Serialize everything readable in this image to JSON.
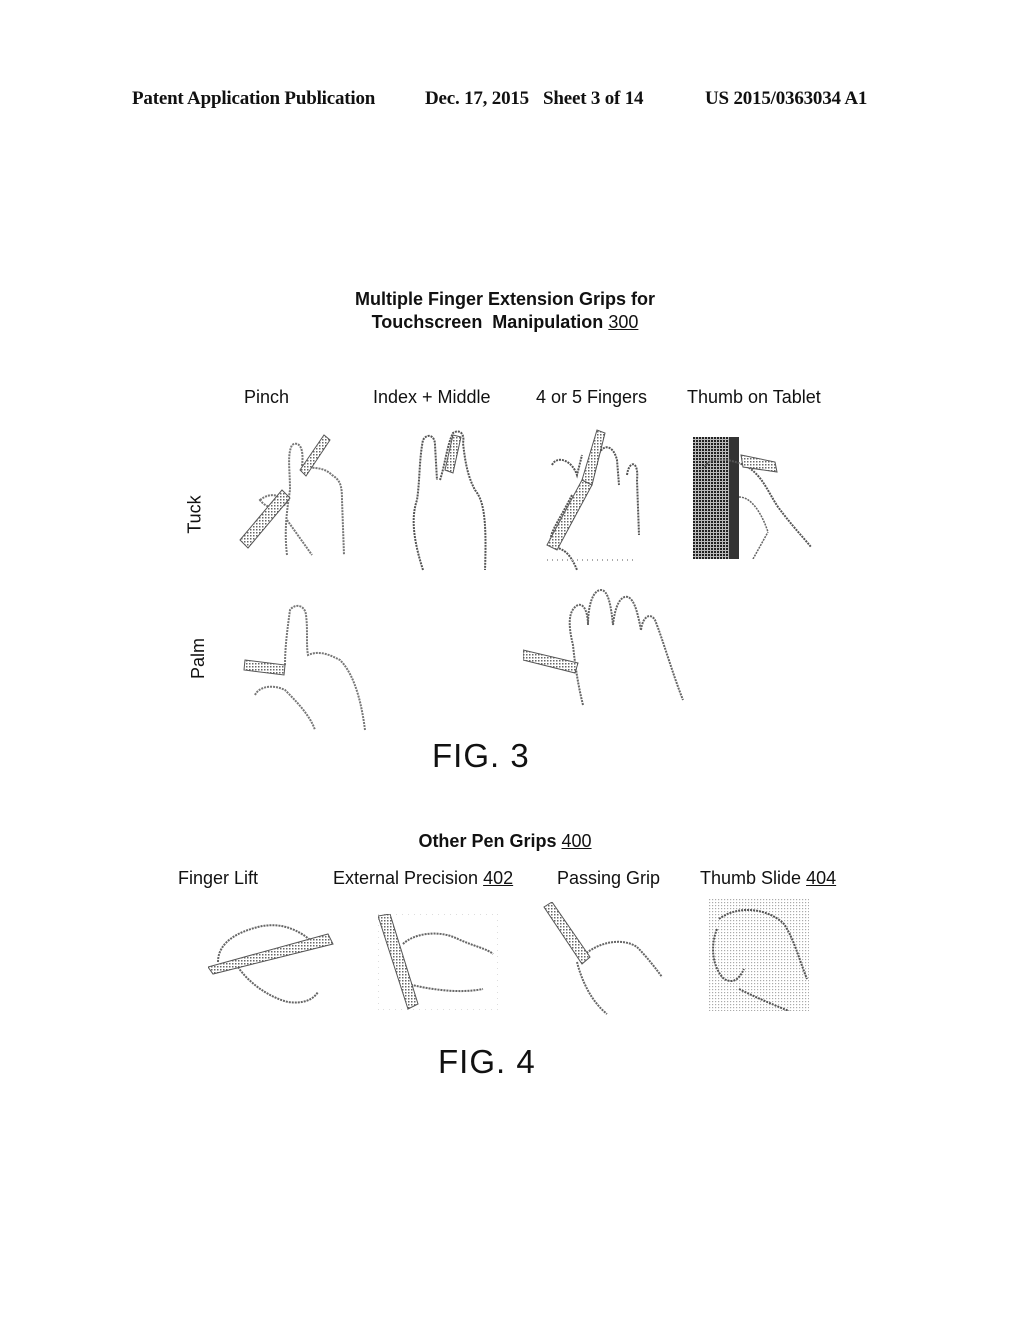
{
  "header": {
    "publication": "Patent Application Publication",
    "date": "Dec. 17, 2015",
    "sheet": "Sheet 3 of 14",
    "number": "US 2015/0363034 A1"
  },
  "fig3": {
    "title_line1": "Multiple Finger Extension Grips for",
    "title_line2": "Touchscreen  Manipulation",
    "ref": "300",
    "columns": [
      "Pinch",
      "Index + Middle",
      "4 or 5 Fingers",
      "Thumb on Tablet"
    ],
    "rows": [
      "Tuck",
      "Palm"
    ],
    "drawings": [
      {
        "row": "Tuck",
        "column": "Pinch",
        "icon": "hand-pinch-tuck-drawing"
      },
      {
        "row": "Tuck",
        "column": "Index + Middle",
        "icon": "hand-index-middle-tuck-drawing"
      },
      {
        "row": "Tuck",
        "column": "4 or 5 Fingers",
        "icon": "hand-four-fingers-tuck-drawing"
      },
      {
        "row": "Tuck",
        "column": "Thumb on Tablet",
        "icon": "hand-thumb-on-tablet-drawing"
      },
      {
        "row": "Palm",
        "column": "Pinch",
        "icon": "hand-pinch-palm-drawing"
      },
      {
        "row": "Palm",
        "column": "4 or 5 Fingers",
        "icon": "hand-four-fingers-palm-drawing"
      }
    ],
    "caption": "FIG. 3"
  },
  "fig4": {
    "title": "Other Pen Grips",
    "ref": "400",
    "grips": [
      {
        "label": "Finger Lift",
        "ref": ""
      },
      {
        "label": "External Precision",
        "ref": "402"
      },
      {
        "label": "Passing Grip",
        "ref": ""
      },
      {
        "label": "Thumb Slide",
        "ref": "404"
      }
    ],
    "caption": "FIG. 4"
  }
}
